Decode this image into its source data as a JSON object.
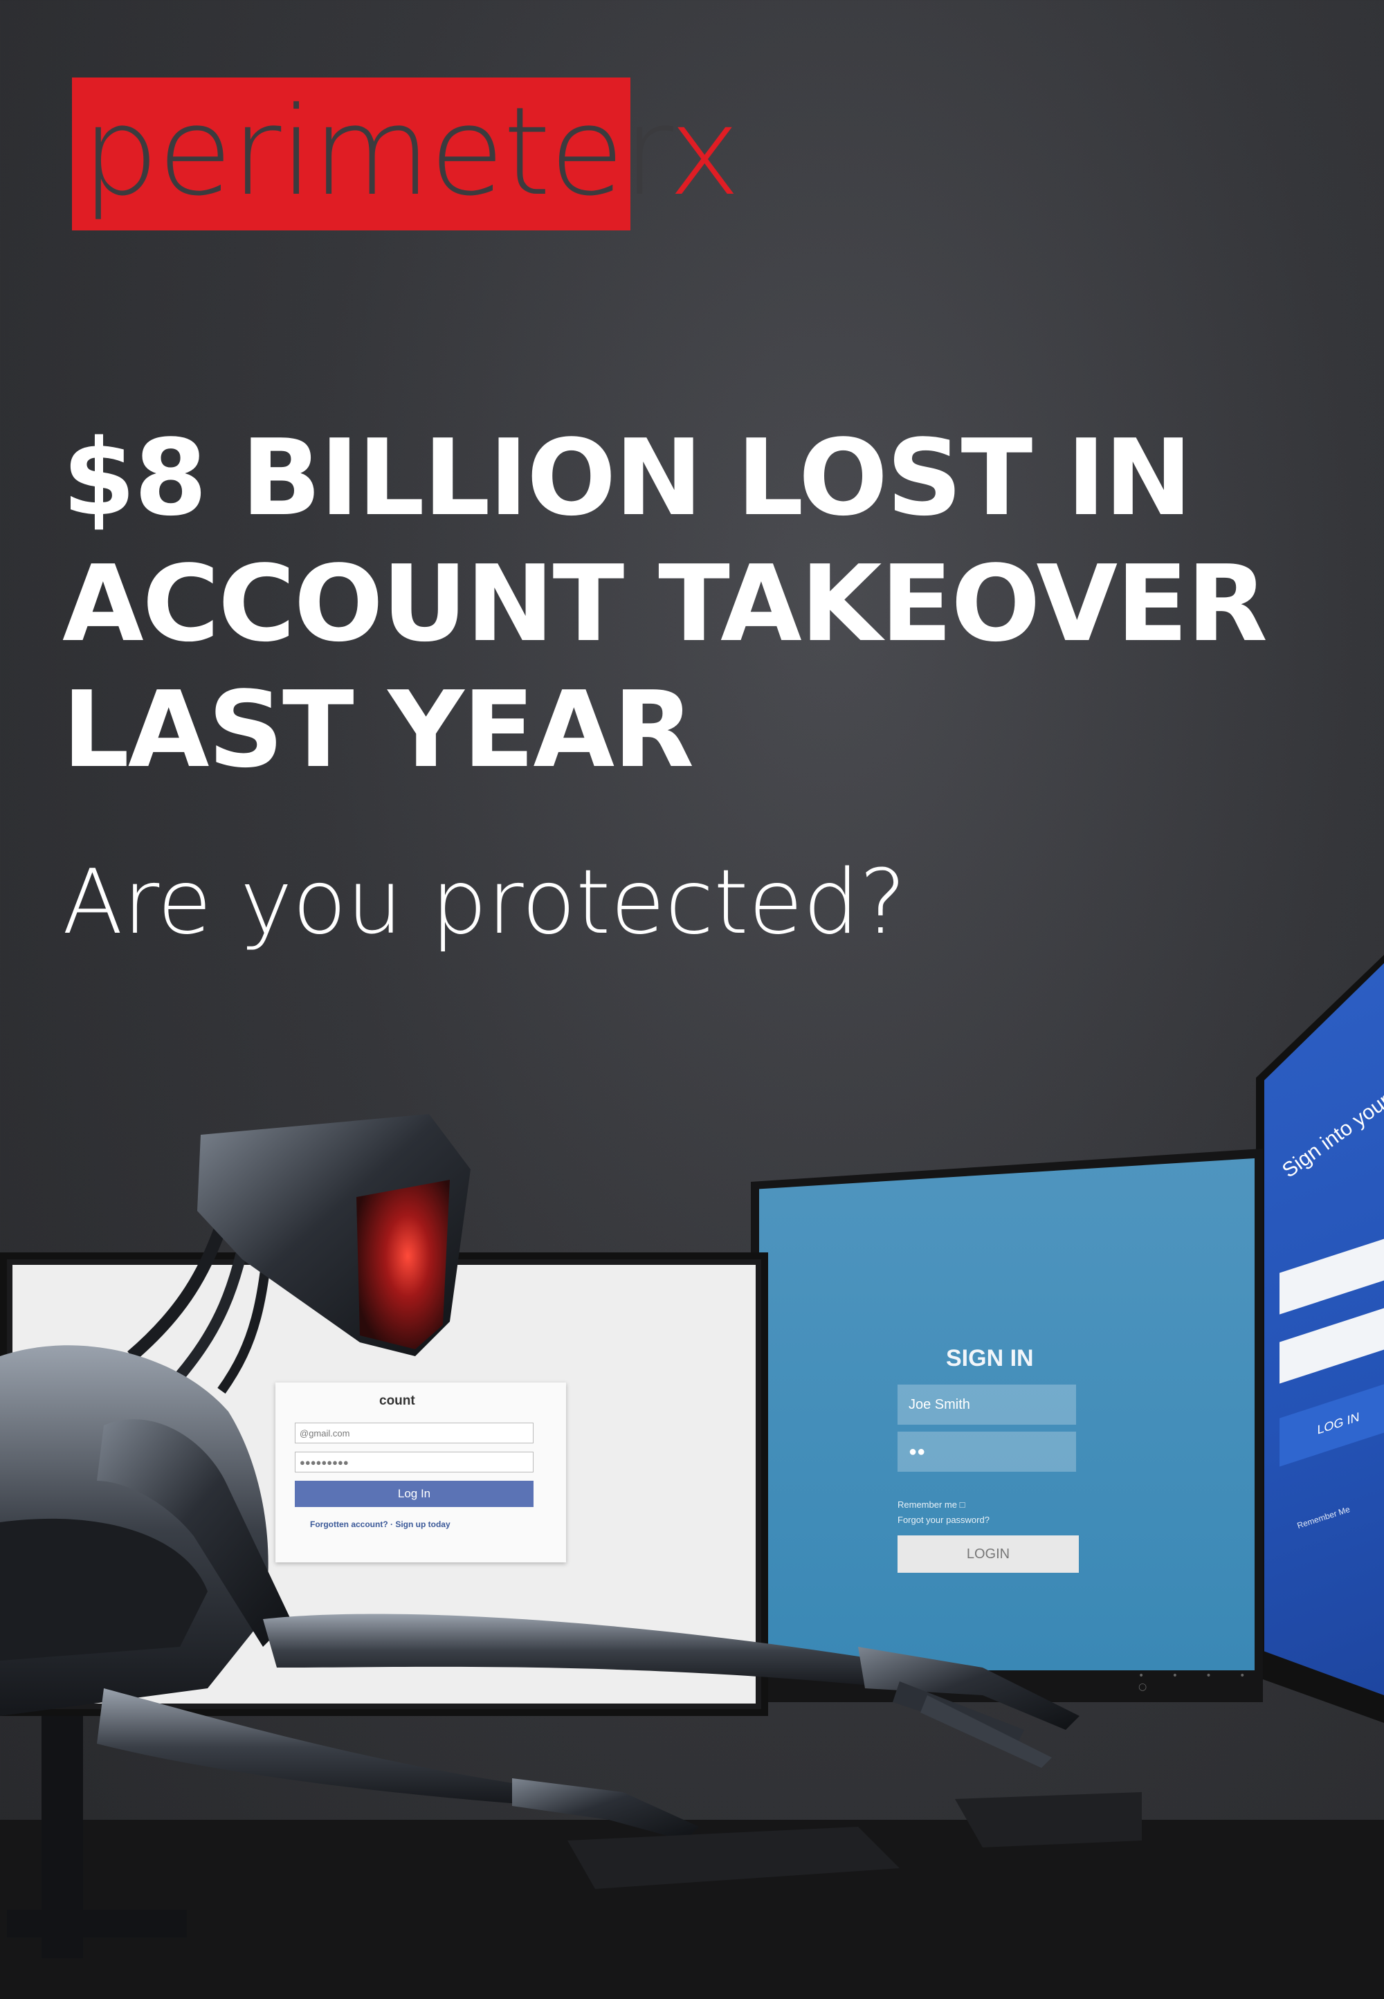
{
  "brand": {
    "logo_text": "perimeterx",
    "logo_main": "perimeter",
    "logo_accent": "x",
    "brand_color": "#e01d24"
  },
  "headline": {
    "lines": [
      "$8 BILLION LOST IN",
      "ACCOUNT TAKEOVER",
      "LAST YEAR"
    ]
  },
  "subheadline": "Are you protected?",
  "screens": {
    "left": {
      "title": "count",
      "email_value": "@gmail.com",
      "password_value": "●●●●●●●●●",
      "login_button": "Log In",
      "links": "Forgotten account? · Sign up today"
    },
    "middle": {
      "title": "SIGN IN",
      "username_value": "Joe Smith",
      "password_value": "●●",
      "remember_label": "Remember me",
      "forgot_label": "Forgot your password?",
      "login_button": "LOGIN"
    },
    "right": {
      "title": "Sign into your accou",
      "login_button": "LOG IN",
      "remember_label": "Remember Me"
    }
  },
  "colors": {
    "background": "#35363a",
    "headline_text": "#ffffff",
    "middle_screen": "#3a88b5",
    "right_screen": "#2453b6",
    "left_login_button": "#5b73b5"
  }
}
